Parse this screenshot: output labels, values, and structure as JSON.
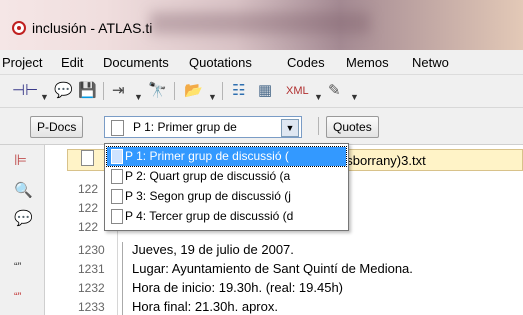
{
  "window": {
    "title": "inclusión - ATLAS.ti"
  },
  "menu": [
    "Project",
    "Edit",
    "Documents",
    "Quotations",
    "Codes",
    "Memos",
    "Netwo"
  ],
  "toolbar": {
    "icons": [
      "code-tool-icon",
      "comment-icon",
      "save-icon",
      "assign-icon",
      "binoculars-icon",
      "open-icon",
      "quotes-tool-icon",
      "pdoc-tool-icon",
      "xml-icon",
      "edit-icon"
    ]
  },
  "docbar": {
    "pdocs_label": "P-Docs",
    "selected_doc": "P 1: Primer grup de",
    "quotes_label": "Quotes"
  },
  "dropdown": {
    "items": [
      "P 1: Primer grup de discussió (",
      "P 2: Quart grup de discussió (a",
      "P 3: Segon grup de discussió (j",
      "P 4: Tercer grup de discussió (d"
    ],
    "selected_index": 0
  },
  "editor": {
    "header_suffix": "esborrany)3.txt",
    "hidden_lines": [
      "122",
      "122",
      "122"
    ],
    "lines": [
      {
        "num": "1230",
        "text": "Jueves, 19 de julio de 2007."
      },
      {
        "num": "1231",
        "text": "Lugar: Ayuntamiento de Sant Quintí de Mediona."
      },
      {
        "num": "1232",
        "text": "Hora de inicio: 19.30h. (real: 19.45h)"
      },
      {
        "num": "1233",
        "text": "Hora final: 21.30h. aprox."
      }
    ]
  },
  "left_tools": [
    "structure-icon",
    "search-icon",
    "comment-icon",
    "quote-icon",
    "quote-link-icon"
  ]
}
